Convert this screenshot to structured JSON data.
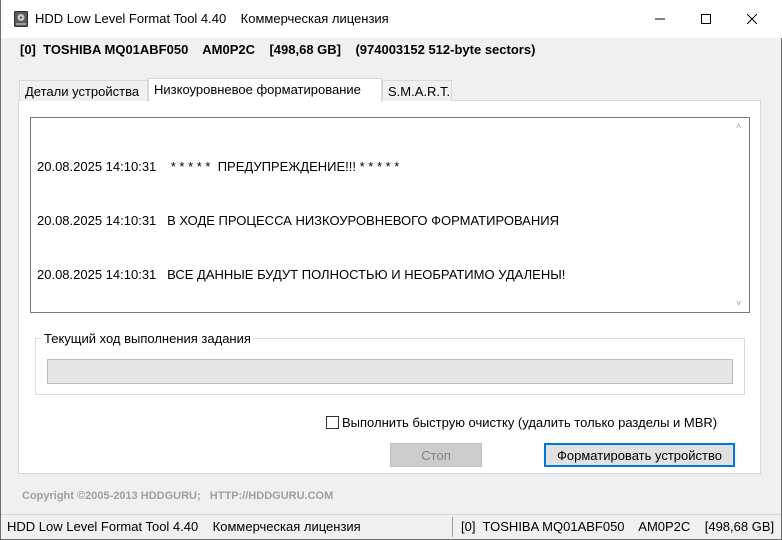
{
  "window": {
    "title": "HDD Low Level Format Tool 4.40    Коммерческая лицензия",
    "minimize_icon": "minimize-icon",
    "maximize_icon": "maximize-icon",
    "close_icon": "close-icon"
  },
  "device": {
    "summary": "[0]  TOSHIBA MQ01ABF050    AM0P2C    [498,68 GB]    (974003152 512-byte sectors)"
  },
  "tabs": [
    {
      "label": "Детали устройства",
      "active": false
    },
    {
      "label": "Низкоуровневое форматирование",
      "active": true
    },
    {
      "label": "S.M.A.R.T.",
      "active": false
    }
  ],
  "log": {
    "lines": [
      "20.08.2025 14:10:31    * * * * *  ПРЕДУПРЕЖДЕНИЕ!!! * * * * *",
      "20.08.2025 14:10:31   В ХОДЕ ПРОЦЕССА НИЗКОУРОВНЕВОГО ФОРМАТИРОВАНИЯ",
      "20.08.2025 14:10:31   ВСЕ ДАННЫЕ БУДУТ ПОЛНОСТЬЮ И НЕОБРАТИМО УДАЛЕНЫ!"
    ]
  },
  "progress": {
    "label": "Текущий ход выполнения задания",
    "value_percent": 0
  },
  "quick_wipe": {
    "label": "Выполнить быструю очистку (удалить только разделы и MBR)",
    "checked": false
  },
  "buttons": {
    "stop": "Стоп",
    "format": "Форматировать устройство"
  },
  "copyright": "Copyright ©2005-2013 HDDGURU;   HTTP://HDDGURU.COM",
  "statusbar": {
    "left": "HDD Low Level Format Tool 4.40    Коммерческая лицензия",
    "right": "[0]  TOSHIBA MQ01ABF050    AM0P2C    [498,68 GB]"
  },
  "colors": {
    "accent_border": "#0078d7",
    "progress_fill": "#06b025"
  }
}
